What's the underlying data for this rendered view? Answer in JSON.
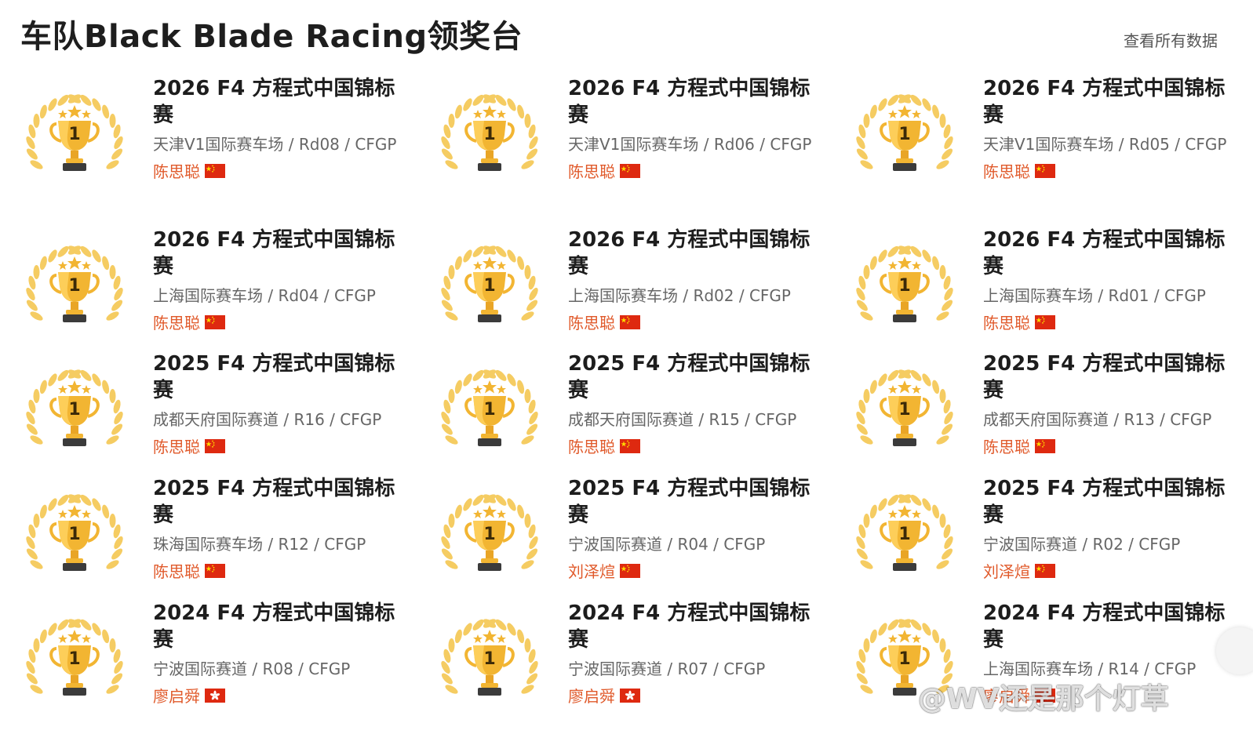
{
  "page": {
    "title": "车队Black Blade Racing领奖台",
    "view_all": "查看所有数据"
  },
  "colors": {
    "driver": "#e0592a",
    "gold": "#f2b532",
    "laurel": "#f5cc62"
  },
  "icons": {
    "trophy": "first-place-trophy-icon",
    "cn_flag": "china-flag-icon",
    "hk_flag": "hong-kong-flag-icon"
  },
  "trophy_rank": "1",
  "podiums": [
    {
      "title": "2026 F4 方程式中国锦标赛",
      "sub": "天津V1国际赛车场 / Rd08 / CFGP",
      "driver": "陈思聪",
      "flag": "cn"
    },
    {
      "title": "2026 F4 方程式中国锦标赛",
      "sub": "天津V1国际赛车场 / Rd06 / CFGP",
      "driver": "陈思聪",
      "flag": "cn"
    },
    {
      "title": "2026 F4 方程式中国锦标赛",
      "sub": "天津V1国际赛车场 / Rd05 / CFGP",
      "driver": "陈思聪",
      "flag": "cn"
    },
    {
      "title": "2026 F4 方程式中国锦标赛",
      "sub": "上海国际赛车场 / Rd04 / CFGP",
      "driver": "陈思聪",
      "flag": "cn"
    },
    {
      "title": "2026 F4 方程式中国锦标赛",
      "sub": "上海国际赛车场 / Rd02 / CFGP",
      "driver": "陈思聪",
      "flag": "cn"
    },
    {
      "title": "2026 F4 方程式中国锦标赛",
      "sub": "上海国际赛车场 / Rd01 / CFGP",
      "driver": "陈思聪",
      "flag": "cn"
    },
    {
      "title": "2025 F4 方程式中国锦标赛",
      "sub": "成都天府国际赛道 / R16 / CFGP",
      "driver": "陈思聪",
      "flag": "cn"
    },
    {
      "title": "2025 F4 方程式中国锦标赛",
      "sub": "成都天府国际赛道 / R15 / CFGP",
      "driver": "陈思聪",
      "flag": "cn"
    },
    {
      "title": "2025 F4 方程式中国锦标赛",
      "sub": "成都天府国际赛道 / R13 / CFGP",
      "driver": "陈思聪",
      "flag": "cn"
    },
    {
      "title": "2025 F4 方程式中国锦标赛",
      "sub": "珠海国际赛车场 / R12 / CFGP",
      "driver": "陈思聪",
      "flag": "cn"
    },
    {
      "title": "2025 F4 方程式中国锦标赛",
      "sub": "宁波国际赛道 / R04 / CFGP",
      "driver": "刘泽煊",
      "flag": "cn"
    },
    {
      "title": "2025 F4 方程式中国锦标赛",
      "sub": "宁波国际赛道 / R02 / CFGP",
      "driver": "刘泽煊",
      "flag": "cn"
    },
    {
      "title": "2024 F4 方程式中国锦标赛",
      "sub": "宁波国际赛道 / R08 / CFGP",
      "driver": "廖启舜",
      "flag": "hk"
    },
    {
      "title": "2024 F4 方程式中国锦标赛",
      "sub": "宁波国际赛道 / R07 / CFGP",
      "driver": "廖启舜",
      "flag": "hk"
    },
    {
      "title": "2024 F4 方程式中国锦标赛",
      "sub": "上海国际赛车场 / R14 / CFGP",
      "driver": "廖启舜",
      "flag": "hk"
    }
  ],
  "watermark": "@WV还是那个灯草"
}
